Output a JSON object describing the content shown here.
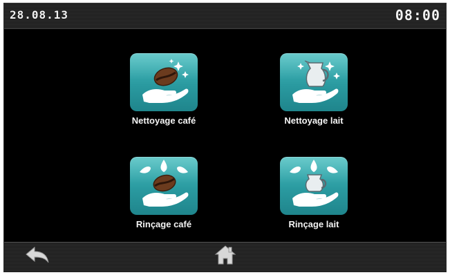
{
  "status_bar": {
    "date": "28.08.13",
    "time": "08:00"
  },
  "tiles": [
    {
      "label": "Nettoyage café",
      "icon": "coffee-bean-clean-icon"
    },
    {
      "label": "Nettoyage lait",
      "icon": "milk-jug-clean-icon"
    },
    {
      "label": "Rinçage café",
      "icon": "coffee-bean-rinse-icon"
    },
    {
      "label": "Rinçage lait",
      "icon": "milk-jug-rinse-icon"
    }
  ],
  "bottom_bar": {
    "back_icon": "back-arrow-icon",
    "home_icon": "home-icon"
  },
  "colors": {
    "screen_background": "#000000",
    "tile_accent": "#2a9aa0",
    "text": "#f4f4f4"
  }
}
